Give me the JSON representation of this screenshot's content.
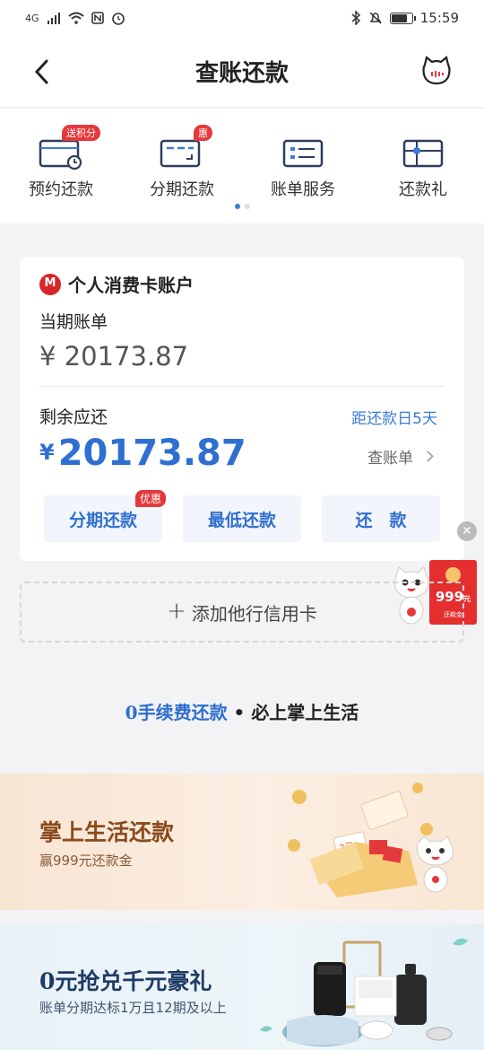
{
  "status_bar": {
    "network": "4G",
    "time": "15:59"
  },
  "header": {
    "title": "查账还款"
  },
  "quick_menu": {
    "items": [
      {
        "label": "预约还款",
        "badge": "送积分",
        "icon": "calendar-clock-icon"
      },
      {
        "label": "分期还款",
        "badge": "惠",
        "icon": "card-split-icon"
      },
      {
        "label": "账单服务",
        "badge": "",
        "icon": "bill-list-icon"
      },
      {
        "label": "还款礼",
        "badge": "",
        "icon": "gift-card-icon"
      }
    ],
    "page_count": 2,
    "active_page": 0
  },
  "account": {
    "name": "个人消费卡账户",
    "current_bill_label": "当期账单",
    "current_bill_amount": "¥ 20173.87",
    "remaining_label": "剩余应还",
    "due_text": "距还款日5天",
    "remaining_currency": "¥",
    "remaining_amount": "20173.87",
    "view_bill": "查账单",
    "buttons": {
      "installment": "分期还款",
      "installment_badge": "优惠",
      "minimum": "最低还款",
      "repay": "还　款"
    }
  },
  "add_card": {
    "label": "添加他行信用卡"
  },
  "float_promo": {
    "amount": "999",
    "unit": "元",
    "caption": "还款金"
  },
  "slogan": {
    "zero": "0",
    "main": "手续费还款",
    "sep": " • ",
    "tail": "必上掌上生活"
  },
  "banner1": {
    "title": "掌上生活还款",
    "subtitle": "赢999元还款金",
    "coupon_text": "2元"
  },
  "banner2": {
    "title": "0元抢兑千元豪礼",
    "subtitle": "账单分期达标1万且12期及以上"
  },
  "colors": {
    "accent": "#2f6fd0",
    "badge_red": "#e4393c",
    "brand_red": "#d7262b"
  }
}
